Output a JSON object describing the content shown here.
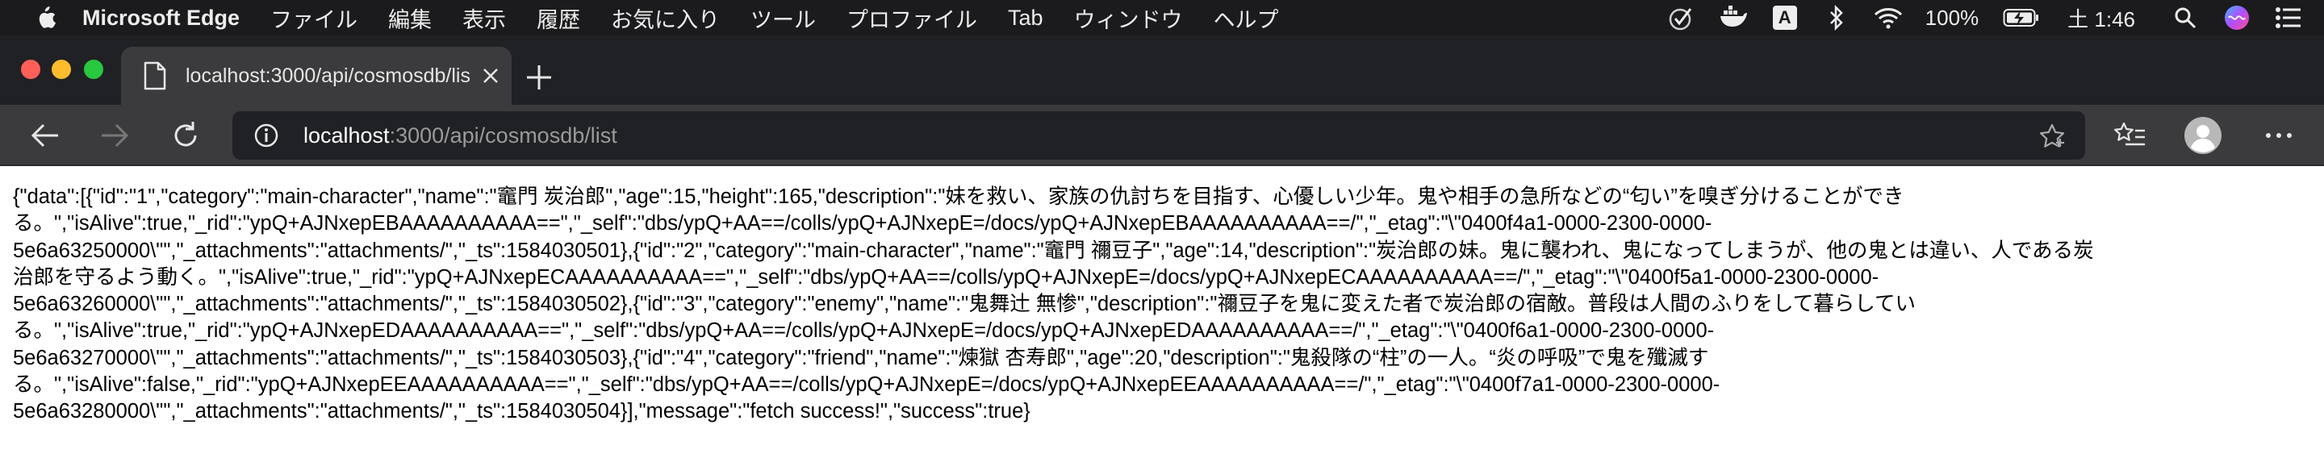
{
  "menubar": {
    "app_name": "Microsoft Edge",
    "items": [
      "ファイル",
      "編集",
      "表示",
      "履歴",
      "お気に入り",
      "ツール",
      "プロファイル",
      "Tab",
      "ウィンドウ",
      "ヘルプ"
    ],
    "battery": "100%",
    "clock": "土 1:46",
    "status_icons": [
      "check-circle-icon",
      "docker-whale-icon",
      "input-source-a-icon",
      "bluetooth-icon",
      "wifi-icon",
      "battery-charging-icon",
      "search-icon",
      "siri-icon",
      "control-center-icon"
    ],
    "input_source_label": "A"
  },
  "tab": {
    "title": "localhost:3000/api/cosmosdb/list"
  },
  "address_bar": {
    "host": "localhost",
    "path": ":3000/api/cosmosdb/list"
  },
  "content": {
    "lines": [
      "{\"data\":[{\"id\":\"1\",\"category\":\"main-character\",\"name\":\"竈門 炭治郎\",\"age\":15,\"height\":165,\"description\":\"妹を救い、家族の仇討ちを目指す、心優しい少年。鬼や相手の急所などの“匂い”を嗅ぎ分けることができ",
      "る。\",\"isAlive\":true,\"_rid\":\"ypQ+AJNxepEBAAAAAAAAAA==\",\"_self\":\"dbs/ypQ+AA==/colls/ypQ+AJNxepE=/docs/ypQ+AJNxepEBAAAAAAAAAA==/\",\"_etag\":\"\\\"0400f4a1-0000-2300-0000-",
      "5e6a63250000\\\"\",\"_attachments\":\"attachments/\",\"_ts\":1584030501},{\"id\":\"2\",\"category\":\"main-character\",\"name\":\"竈門 禰豆子\",\"age\":14,\"description\":\"炭治郎の妹。鬼に襲われ、鬼になってしまうが、他の鬼とは違い、人である炭",
      "治郎を守るよう動く。\",\"isAlive\":true,\"_rid\":\"ypQ+AJNxepECAAAAAAAAAA==\",\"_self\":\"dbs/ypQ+AA==/colls/ypQ+AJNxepE=/docs/ypQ+AJNxepECAAAAAAAAAA==/\",\"_etag\":\"\\\"0400f5a1-0000-2300-0000-",
      "5e6a63260000\\\"\",\"_attachments\":\"attachments/\",\"_ts\":1584030502},{\"id\":\"3\",\"category\":\"enemy\",\"name\":\"鬼舞辻 無惨\",\"description\":\"禰豆子を鬼に変えた者で炭治郎の宿敵。普段は人間のふりをして暮らしてい",
      "る。\",\"isAlive\":true,\"_rid\":\"ypQ+AJNxepEDAAAAAAAAAA==\",\"_self\":\"dbs/ypQ+AA==/colls/ypQ+AJNxepE=/docs/ypQ+AJNxepEDAAAAAAAAAA==/\",\"_etag\":\"\\\"0400f6a1-0000-2300-0000-",
      "5e6a63270000\\\"\",\"_attachments\":\"attachments/\",\"_ts\":1584030503},{\"id\":\"4\",\"category\":\"friend\",\"name\":\"煉獄 杏寿郎\",\"age\":20,\"description\":\"鬼殺隊の“柱”の一人。“炎の呼吸”で鬼を殲滅す",
      "る。\",\"isAlive\":false,\"_rid\":\"ypQ+AJNxepEEAAAAAAAAAA==\",\"_self\":\"dbs/ypQ+AA==/colls/ypQ+AJNxepE=/docs/ypQ+AJNxepEEAAAAAAAAAA==/\",\"_etag\":\"\\\"0400f7a1-0000-2300-0000-",
      "5e6a63280000\\\"\",\"_attachments\":\"attachments/\",\"_ts\":1584030504}],\"message\":\"fetch success!\",\"success\":true}"
    ]
  },
  "colors": {
    "menubar_bg": "#1b1b1d",
    "tabstrip_bg": "#202124",
    "toolbar_bg": "#3b3b3d",
    "close_red": "#ff5f57",
    "minimize_yellow": "#febc2e",
    "zoom_green": "#28c840"
  }
}
